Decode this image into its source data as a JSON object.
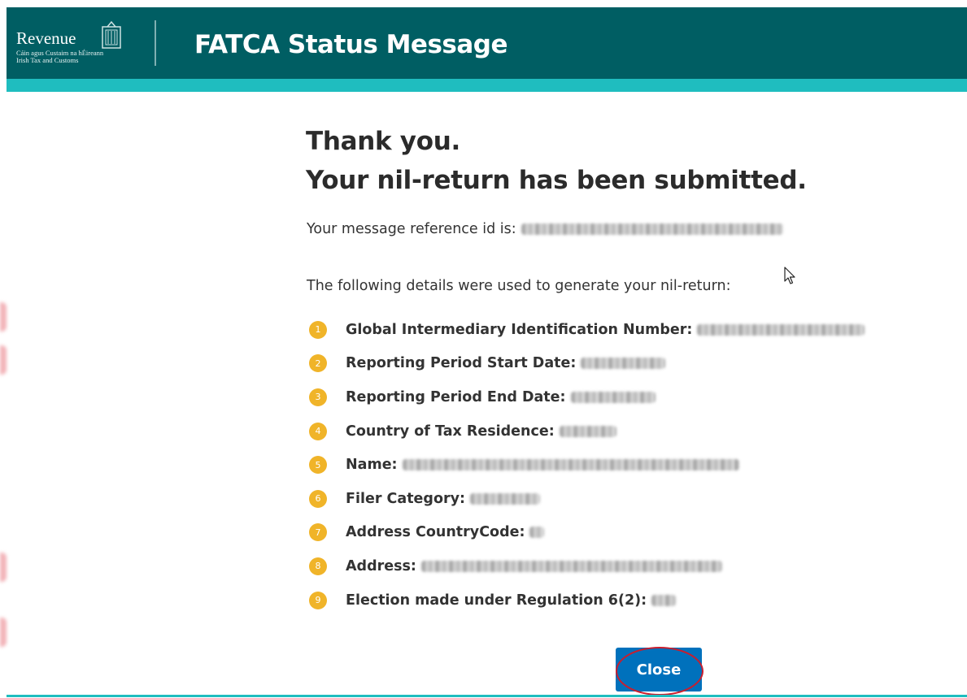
{
  "header": {
    "logo": {
      "wordmark": "Revenue",
      "subtitle_line1": "Cáin agus Custaim na hÉireann",
      "subtitle_line2": "Irish Tax and Customs"
    },
    "title": "FATCA Status Message"
  },
  "main": {
    "heading_line1": "Thank you.",
    "heading_line2": "Your nil-return has been submitted.",
    "reference_label": "Your message reference id is:",
    "intro": "The following details were used to generate your nil-return:",
    "details": [
      {
        "number": "1",
        "label": "Global Intermediary Identification Number:"
      },
      {
        "number": "2",
        "label": "Reporting Period Start Date:"
      },
      {
        "number": "3",
        "label": "Reporting Period End Date:"
      },
      {
        "number": "4",
        "label": "Country of Tax Residence:"
      },
      {
        "number": "5",
        "label": "Name:"
      },
      {
        "number": "6",
        "label": "Filer Category:"
      },
      {
        "number": "7",
        "label": "Address CountryCode:"
      },
      {
        "number": "8",
        "label": "Address:"
      },
      {
        "number": "9",
        "label": "Election made under Regulation 6(2):"
      }
    ]
  },
  "footer": {
    "close_label": "Close"
  },
  "colors": {
    "header_bg": "#005e63",
    "header_stripe": "#1fbdbf",
    "bullet": "#f0b429",
    "button": "#0071bc",
    "highlight": "#c81e2e"
  },
  "icons": {
    "logo": "harp-logo-icon",
    "cursor": "mouse-pointer-icon"
  }
}
